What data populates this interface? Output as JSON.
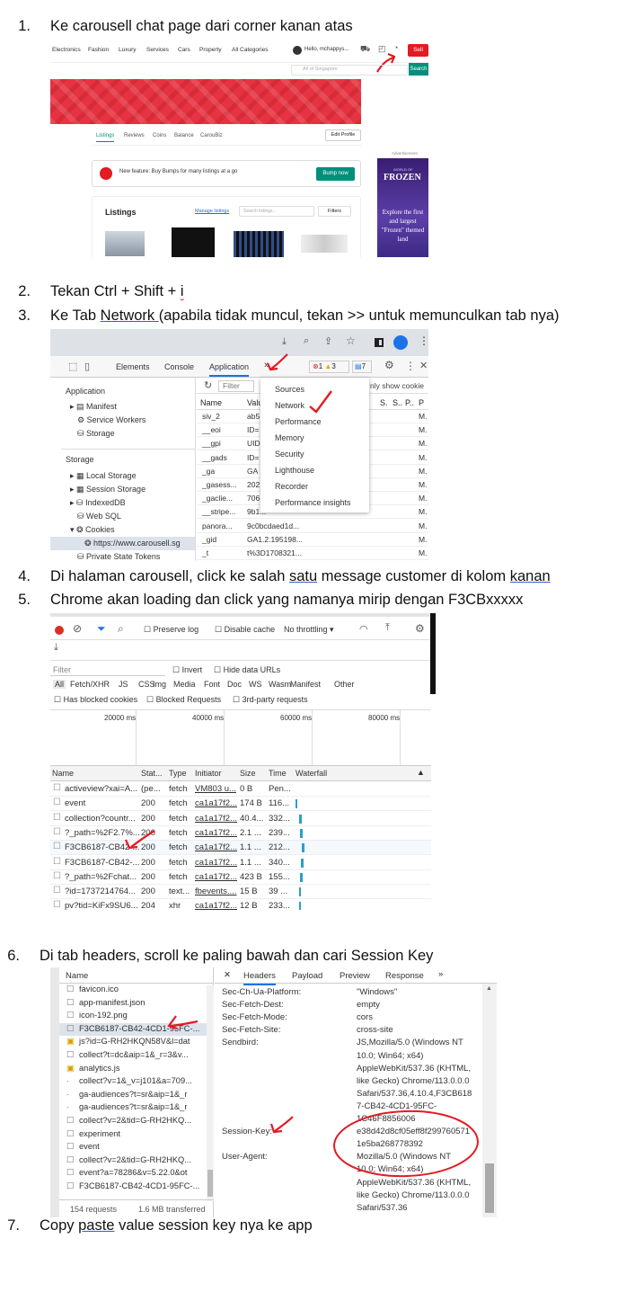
{
  "steps": [
    {
      "num": "1.",
      "pre": "Ke carousell chat page dari corner kanan atas",
      "link": "",
      "post": "",
      "wavy": ""
    },
    {
      "num": "2.",
      "pre": "Tekan Ctrl + Shift + ",
      "link": "",
      "post": "",
      "wavy": "i"
    },
    {
      "num": "3.",
      "pre": "Ke Tab ",
      "link": "Network ",
      "post": " (apabila tidak muncul, tekan >> untuk memunculkan tab nya)",
      "wavy": ""
    },
    {
      "num": "4.",
      "pre": "Di halaman carousell, click ke salah ",
      "link": "satu",
      "post": " message customer di kolom ",
      "wavy": "",
      "link2": "kanan"
    },
    {
      "num": "5.",
      "pre": "Chrome akan loading dan click yang namanya mirip dengan F3CBxxxxx",
      "link": "",
      "post": "",
      "wavy": ""
    },
    {
      "num": "6.",
      "pre": "Di tab headers, scroll ke paling bawah dan cari Session Key",
      "link": "",
      "post": "",
      "wavy": ""
    },
    {
      "num": "7.",
      "pre": "Copy ",
      "link": "paste",
      "post": " value session key nya ke app",
      "wavy": ""
    }
  ],
  "shot1": {
    "nav": [
      "Electronics",
      "Fashion",
      "Luxury",
      "Services",
      "Cars",
      "Property",
      "All Categories"
    ],
    "hello": "Hello, mchappys...",
    "sell": "Sell",
    "location": "All of Singapore",
    "search": "Search",
    "tabs": [
      "Listings",
      "Reviews",
      "Coins",
      "Balance",
      "CarouBiz"
    ],
    "edit_profile": "Edit Profile",
    "advert": "Advertisement",
    "bump_text": "New feature: Buy Bumps for many listings at a go",
    "bump_btn": "Bump now",
    "listings": "Listings",
    "manage": "Manage listings",
    "search_listings": "Search listings...",
    "filters": "Filters",
    "ad_small": "WORLD OF",
    "ad_title": "FROZEN",
    "ad_text": "Explore the first and largest \"Frozen\" themed land"
  },
  "shot2": {
    "tabs": [
      "Elements",
      "Console",
      "Application"
    ],
    "errors": "1",
    "warnings": "3",
    "messages": "7",
    "filter": "Filter",
    "only_show": "nly show cookie",
    "sidebar_app": "Application",
    "app_items": [
      "Manifest",
      "Service Workers",
      "Storage"
    ],
    "sidebar_storage": "Storage",
    "storage_items": [
      "Local Storage",
      "Session Storage",
      "IndexedDB",
      "Web SQL",
      "Cookies",
      "https://www.carousell.sg",
      "Private State Tokens"
    ],
    "menu": [
      "Sources",
      "Network",
      "Performance",
      "Memory",
      "Security",
      "Lighthouse",
      "Recorder",
      "Performance insights"
    ],
    "col_name": "Name",
    "col_val": "Valu",
    "cols_right": [
      "S.",
      "S..",
      "P..",
      "P"
    ],
    "cookie_names": [
      "siv_2",
      "__eoi",
      "__gpi",
      "__gads",
      "_ga",
      "_gasess...",
      "_gaclie...",
      "__stripe...",
      "panora...",
      "_gid",
      "_t"
    ],
    "cookie_vals": [
      "ab5",
      "ID=",
      "UID",
      "ID=",
      "GA",
      "202",
      "706",
      "9b1...",
      "9c0bcdaed1d...",
      "GA1.2.195198...",
      "t%3D1708321..."
    ],
    "m": "M."
  },
  "shot3": {
    "preserve": "Preserve log",
    "disable_cache": "Disable cache",
    "throttle": "No throttling",
    "filter": "Filter",
    "invert": "Invert",
    "hide_data": "Hide data URLs",
    "types": [
      "All",
      "Fetch/XHR",
      "JS",
      "CSS",
      "Img",
      "Media",
      "Font",
      "Doc",
      "WS",
      "Wasm",
      "Manifest",
      "Other"
    ],
    "blocked_cookies": "Has blocked cookies",
    "blocked_req": "Blocked Requests",
    "third_party": "3rd-party requests",
    "ticks": [
      "20000 ms",
      "40000 ms",
      "60000 ms",
      "80000 ms"
    ],
    "headers": [
      "Name",
      "Stat...",
      "Type",
      "Initiator",
      "Size",
      "Time",
      "Waterfall"
    ],
    "rows": [
      [
        "activeview?xai=A...",
        "(pe...",
        "fetch",
        "VM803 u...",
        "0 B",
        "Pen..."
      ],
      [
        "event",
        "200",
        "fetch",
        "ca1a17f2...",
        "174 B",
        "116..."
      ],
      [
        "collection?countr...",
        "200",
        "fetch",
        "ca1a17f2...",
        "40.4...",
        "332..."
      ],
      [
        "?_path=%2F2.7%...",
        "200",
        "fetch",
        "ca1a17f2...",
        "2.1 ...",
        "239..."
      ],
      [
        "F3CB6187-CB42-...",
        "200",
        "fetch",
        "ca1a17f2...",
        "1.1 ...",
        "212..."
      ],
      [
        "F3CB6187-CB42-...",
        "200",
        "fetch",
        "ca1a17f2...",
        "1.1 ...",
        "340..."
      ],
      [
        "?_path=%2Fchat...",
        "200",
        "fetch",
        "ca1a17f2...",
        "423 B",
        "155..."
      ],
      [
        "?id=1737214764...",
        "200",
        "text...",
        "fbevents....",
        "15 B",
        "39 ..."
      ],
      [
        "pv?tid=KiFx9SU6...",
        "204",
        "xhr",
        "ca1a17f2...",
        "12 B",
        "233..."
      ]
    ]
  },
  "shot4": {
    "name_header": "Name",
    "files": [
      "favicon.ico",
      "app-manifest.json",
      "icon-192.png",
      "F3CB6187-CB42-4CD1-95FC-...",
      "js?id=G-RH2HKQN58V&l=dat",
      "collect?t=dc&aip=1&_r=3&v...",
      "analytics.js",
      "collect?v=1&_v=j101&a=709...",
      "ga-audiences?t=sr&aip=1&_r",
      "ga-audiences?t=sr&aip=1&_r",
      "collect?v=2&tid=G-RH2HKQ...",
      "experiment",
      "event",
      "collect?v=2&tid=G-RH2HKQ...",
      "event?a=78286&v=5.22.0&ot",
      "F3CB6187-CB42-4CD1-95FC-..."
    ],
    "requests": "154 requests",
    "transferred": "1.6 MB transferred",
    "tabs": [
      "Headers",
      "Payload",
      "Preview",
      "Response"
    ],
    "headers": [
      {
        "k": "Sec-Ch-Ua-Platform:",
        "v": [
          "\"Windows\""
        ]
      },
      {
        "k": "Sec-Fetch-Dest:",
        "v": [
          "empty"
        ]
      },
      {
        "k": "Sec-Fetch-Mode:",
        "v": [
          "cors"
        ]
      },
      {
        "k": "Sec-Fetch-Site:",
        "v": [
          "cross-site"
        ]
      },
      {
        "k": "Sendbird:",
        "v": [
          "JS,Mozilla/5.0 (Windows NT",
          "10.0; Win64; x64)",
          "AppleWebKit/537.36 (KHTML,",
          "like Gecko) Chrome/113.0.0.0",
          "Safari/537.36,4.10.4,F3CB618",
          "7-CB42-4CD1-95FC-",
          "1C46F8856006"
        ]
      },
      {
        "k": "Session-Key:",
        "v": [
          "e38d42d8cf05eff8f299760571",
          "1e5ba268778392"
        ]
      },
      {
        "k": "User-Agent:",
        "v": [
          "Mozilla/5.0 (Windows NT",
          "10.0; Win64; x64)",
          "AppleWebKit/537.36 (KHTML,",
          "like Gecko) Chrome/113.0.0.0",
          "Safari/537.36"
        ]
      }
    ]
  }
}
